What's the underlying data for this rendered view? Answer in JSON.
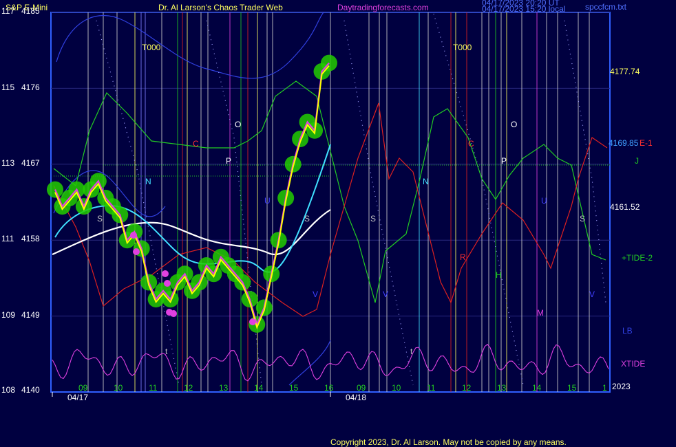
{
  "header": {
    "instrument": "S&P E-Mini",
    "author": "Dr. Al Larson's Chaos Trader Web",
    "site": "Daytradingforecasts.com",
    "stamp_line1": "04/17/2023 20:20 UT",
    "stamp_line2": "04/17/2023 15:20 local",
    "file": "spccfcm.txt"
  },
  "footer": {
    "copyright": "Copyright 2023, Dr. Al Larson. May not be copied by any means."
  },
  "colors": {
    "background": "#000040",
    "frame": "#3060ff",
    "price": "#ffff00",
    "price_glow": "#22cc00",
    "xtide": "#e040e0",
    "tide": "#22cc22",
    "red_line": "#dd2020",
    "cyan_avg": "#40e0ff",
    "white_avg": "#ffffff",
    "band": "#3040e0"
  },
  "chart_data": {
    "type": "line",
    "title": "S&P E-Mini",
    "y_left_labels": [
      {
        "tide": "117",
        "price": "4185"
      },
      {
        "tide": "115",
        "price": "4176"
      },
      {
        "tide": "113",
        "price": "4167"
      },
      {
        "tide": "111",
        "price": "4158"
      },
      {
        "tide": "109",
        "price": "4149"
      },
      {
        "tide": "108",
        "price": "4140"
      }
    ],
    "ylim": [
      4140,
      4185
    ],
    "x_hour_labels": [
      "09",
      "10",
      "11",
      "12",
      "13",
      "14",
      "15",
      "16",
      "09",
      "10",
      "11",
      "12",
      "13",
      "14",
      "15",
      "1"
    ],
    "x_date_labels": [
      "04/17",
      "04/18"
    ],
    "year_label": "2023",
    "right_labels": [
      "4177.74",
      "4169.85",
      "E-1",
      "J",
      "4161.52",
      "+TIDE-2",
      "LB",
      "XTIDE"
    ],
    "marker_labels": [
      "T000",
      "T000",
      "O",
      "O",
      "C",
      "C",
      "P",
      "P",
      "N",
      "N",
      "S",
      "S",
      "S",
      "S",
      "V",
      "V",
      "V",
      "R",
      "H",
      "M",
      "U",
      "U",
      "t",
      "t"
    ],
    "series": [
      {
        "name": "price",
        "x": [
          "09:30",
          "09:40",
          "09:50",
          "10:00",
          "10:10",
          "10:20",
          "10:30",
          "10:40",
          "10:50",
          "11:00",
          "11:10",
          "11:20",
          "11:30",
          "11:40",
          "11:50",
          "12:00",
          "12:10",
          "12:20",
          "12:30",
          "12:40",
          "12:50",
          "13:00",
          "13:10",
          "13:20",
          "13:30",
          "13:40",
          "13:50",
          "14:00",
          "14:10",
          "14:20",
          "14:30",
          "14:40",
          "14:50",
          "15:00",
          "15:10",
          "15:20",
          "15:30",
          "15:40",
          "15:50"
        ],
        "values": [
          4164,
          4162,
          4163,
          4164,
          4162,
          4164,
          4165,
          4163,
          4162,
          4161,
          4158,
          4159,
          4157,
          4153,
          4151,
          4152,
          4151,
          4153,
          4154,
          4152,
          4153,
          4155,
          4154,
          4156,
          4155,
          4154,
          4153,
          4151,
          4148,
          4150,
          4154,
          4158,
          4163,
          4167,
          4170,
          4172,
          4171,
          4178,
          4179
        ]
      }
    ]
  }
}
